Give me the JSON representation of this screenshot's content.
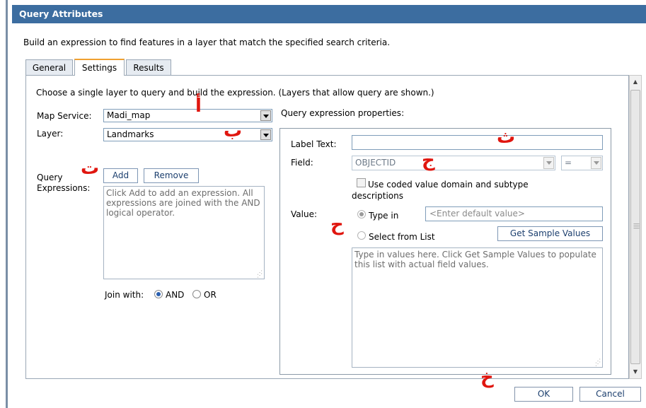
{
  "window": {
    "title": "Query Attributes"
  },
  "instruction": "Build an expression to find features in a layer that match the specified search criteria.",
  "tabs": [
    {
      "label": "General",
      "active": false
    },
    {
      "label": "Settings",
      "active": true
    },
    {
      "label": "Results",
      "active": false
    }
  ],
  "settings": {
    "intro": "Choose a single layer to query and build the expression. (Layers that allow query are shown.)",
    "map_service": {
      "label": "Map Service:",
      "value": "Madi_map"
    },
    "layer": {
      "label": "Layer:",
      "value": "Landmarks"
    },
    "query_expressions": {
      "label_line1": "Query",
      "label_line2": "Expressions:",
      "add_label": "Add",
      "remove_label": "Remove",
      "placeholder": "Click Add to add an expression. All expressions are joined with the AND logical operator."
    },
    "join": {
      "label": "Join with:",
      "and_label": "AND",
      "or_label": "OR",
      "selected": "AND"
    }
  },
  "properties": {
    "heading": "Query expression properties:",
    "label_text": {
      "label": "Label Text:",
      "value": ""
    },
    "field": {
      "label": "Field:",
      "value": "OBJECTID",
      "operator": "="
    },
    "coded_values": {
      "label_line1": "Use coded value domain and subtype",
      "label_line2": "descriptions",
      "checked": false
    },
    "value": {
      "label": "Value:",
      "type_in_label": "Type in",
      "default_placeholder": "<Enter default value>",
      "select_list_label": "Select from List",
      "get_sample_label": "Get Sample Values",
      "list_placeholder": "Type in values here. Click Get Sample Values to populate this list with actual field values.",
      "selected": "Type in"
    }
  },
  "footer": {
    "ok_label": "OK",
    "cancel_label": "Cancel"
  },
  "annotations": {
    "a": "أ",
    "b": "ب",
    "t": "ت",
    "th": "ث",
    "j": "ج",
    "h": "ح",
    "kh": "خ"
  },
  "colors": {
    "titlebar": "#3c6da0",
    "annotation": "#e0160f",
    "active_tab_accent": "#f0a030"
  }
}
